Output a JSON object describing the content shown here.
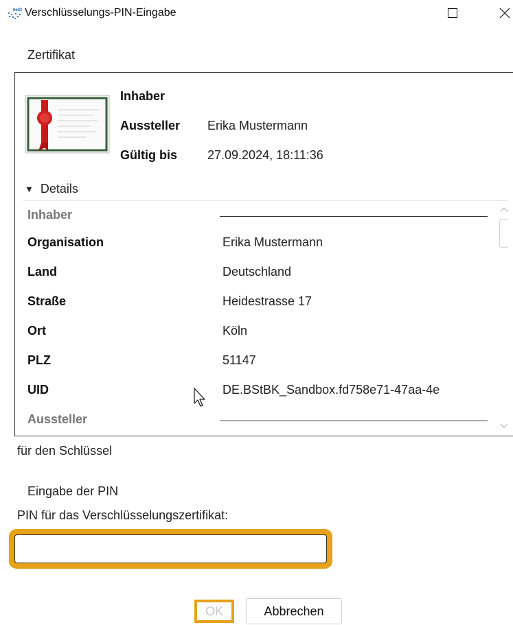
{
  "window": {
    "title": "Verschlüsselungs-PIN-Eingabe",
    "app_icon": "app-logo-icon",
    "maximize_icon": "maximize-icon",
    "close_icon": "close-icon"
  },
  "certificate_section": {
    "label": "Zertifikat",
    "icon": "certificate-icon",
    "fields": [
      {
        "key": "Inhaber",
        "value": ""
      },
      {
        "key": "Aussteller",
        "value": "Erika Mustermann"
      },
      {
        "key": "Gültig bis",
        "value": "27.09.2024, 18:11:36"
      }
    ],
    "details_toggle": "Details",
    "details": {
      "group_inhaber": "Inhaber",
      "rows": [
        {
          "key": "Organisation",
          "value": "Erika Mustermann"
        },
        {
          "key": "Land",
          "value": "Deutschland"
        },
        {
          "key": "Straße",
          "value": "Heidestrasse 17"
        },
        {
          "key": "Ort",
          "value": "Köln"
        },
        {
          "key": "PLZ",
          "value": "51147"
        },
        {
          "key": "UID",
          "value": "DE.BStBK_Sandbox.fd758e71-47aa-4e"
        }
      ],
      "group_aussteller": "Aussteller"
    }
  },
  "for_key_label": "für den Schlüssel",
  "pin_section": {
    "label": "Eingabe der PIN",
    "field_label": "PIN für das Verschlüsselungszertifikat:",
    "value": "",
    "placeholder": ""
  },
  "buttons": {
    "ok": "OK",
    "cancel": "Abbrechen"
  },
  "colors": {
    "focus_highlight": "#e6a21a",
    "seal_red": "#cc1a1a",
    "cert_frame": "#3a5f3a"
  }
}
